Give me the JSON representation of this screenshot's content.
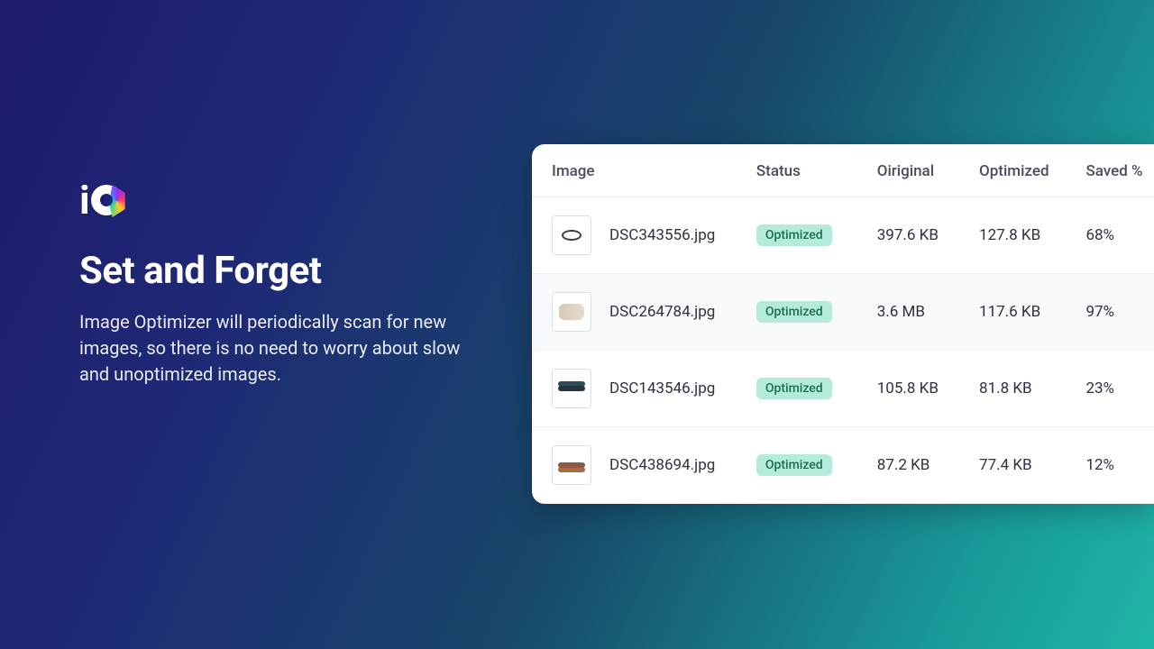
{
  "hero": {
    "headline": "Set and Forget",
    "description": "Image Optimizer will periodically scan for new images, so there is no need to worry about slow and unoptimized images."
  },
  "table": {
    "headers": {
      "image": "Image",
      "status": "Status",
      "original": "Oiriginal",
      "optimized": "Optimized",
      "saved": "Saved %"
    },
    "rows": [
      {
        "filename": "DSC343556.jpg",
        "status": "Optimized",
        "original": "397.6 KB",
        "optimized": "127.8 KB",
        "saved": "68%"
      },
      {
        "filename": "DSC264784.jpg",
        "status": "Optimized",
        "original": "3.6 MB",
        "optimized": "117.6 KB",
        "saved": "97%"
      },
      {
        "filename": "DSC143546.jpg",
        "status": "Optimized",
        "original": "105.8 KB",
        "optimized": "81.8 KB",
        "saved": "23%"
      },
      {
        "filename": "DSC438694.jpg",
        "status": "Optimized",
        "original": "87.2 KB",
        "optimized": "77.4 KB",
        "saved": "12%"
      }
    ]
  }
}
